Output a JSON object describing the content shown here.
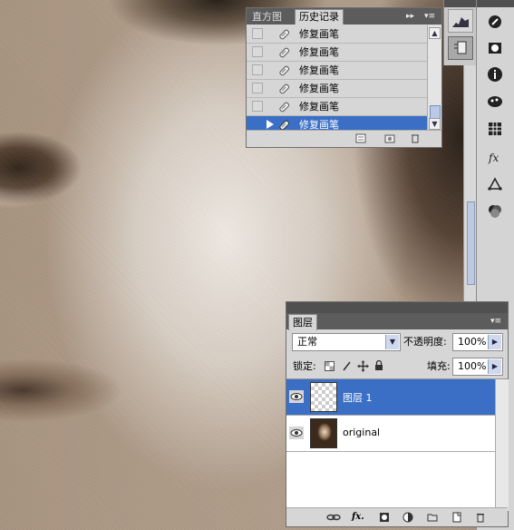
{
  "history_panel": {
    "tabs": [
      "直方图",
      "历史记录"
    ],
    "active_tab": "历史记录",
    "steps": [
      {
        "label": "修复画笔",
        "selected": false
      },
      {
        "label": "修复画笔",
        "selected": false
      },
      {
        "label": "修复画笔",
        "selected": false
      },
      {
        "label": "修复画笔",
        "selected": false
      },
      {
        "label": "修复画笔",
        "selected": false
      },
      {
        "label": "修复画笔",
        "selected": true
      }
    ],
    "menu_glyph": "▸▸",
    "footer_icons": [
      "new-document-from-state-icon",
      "new-snapshot-icon",
      "delete-state-icon"
    ]
  },
  "dock": {
    "buttons": [
      "histogram-icon",
      "history-icon"
    ]
  },
  "toolbar": {
    "icons": [
      "navigator-icon",
      "masks-icon",
      "info-icon",
      "styles-icon",
      "swatches-icon",
      "actions-icon",
      "paths-icon",
      "channels-icon"
    ]
  },
  "layers_panel": {
    "tab": "图层",
    "blend_mode": "正常",
    "opacity_label": "不透明度:",
    "opacity_value": "100%",
    "lock_label": "锁定:",
    "fill_label": "填充:",
    "fill_value": "100%",
    "layers": [
      {
        "name": "图层 1",
        "selected": true,
        "visible": true
      },
      {
        "name": "original",
        "selected": false,
        "visible": true
      }
    ],
    "footer_icons": [
      "link-layers-icon",
      "fx-icon",
      "add-mask-icon",
      "adjustment-layer-icon",
      "new-group-icon",
      "new-layer-icon",
      "delete-layer-icon"
    ],
    "footer_fx_text": "fx."
  },
  "colors": {
    "selection": "#3a6fc5",
    "panel_bg": "#d6d6d6",
    "panel_header": "#5c5c5c"
  }
}
